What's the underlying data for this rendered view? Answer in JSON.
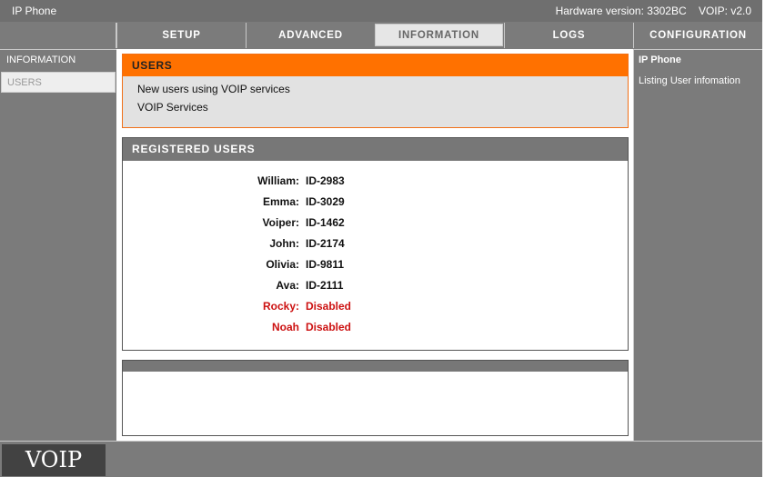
{
  "topbar": {
    "product": "IP Phone",
    "hardware": "Hardware version: 3302BC    VOIP: v2.0"
  },
  "nav": {
    "tabs": [
      "SETUP",
      "ADVANCED",
      "INFORMATION",
      "LOGS"
    ],
    "active_tab": "INFORMATION",
    "right_label": "CONFIGURATION"
  },
  "sidebar": {
    "items": [
      "INFORMATION",
      "USERS"
    ],
    "selected": "USERS"
  },
  "users_section": {
    "title": "USERS",
    "line1": "New users using VOIP services",
    "line2": "VOIP Services"
  },
  "registered": {
    "title": "REGISTERED USERS",
    "users": [
      {
        "name": "William:",
        "id": "ID-2983",
        "status": "active"
      },
      {
        "name": "Emma:",
        "id": "ID-3029",
        "status": "active"
      },
      {
        "name": "Voiper:",
        "id": "ID-1462",
        "status": "active"
      },
      {
        "name": "John:",
        "id": "ID-2174",
        "status": "active"
      },
      {
        "name": "Olivia:",
        "id": "ID-9811",
        "status": "active"
      },
      {
        "name": "Ava:",
        "id": "ID-2111",
        "status": "active"
      },
      {
        "name": "Rocky:",
        "id": "Disabled",
        "status": "disabled"
      },
      {
        "name": "Noah",
        "id": "Disabled",
        "status": "disabled"
      }
    ]
  },
  "right_panel": {
    "title": "IP Phone",
    "description": "Listing User infomation"
  },
  "footer": {
    "logo": "VOIP"
  },
  "colors": {
    "accent": "#ff7100",
    "panel_gray": "#7b7b7b",
    "disabled_red": "#cc1111"
  }
}
